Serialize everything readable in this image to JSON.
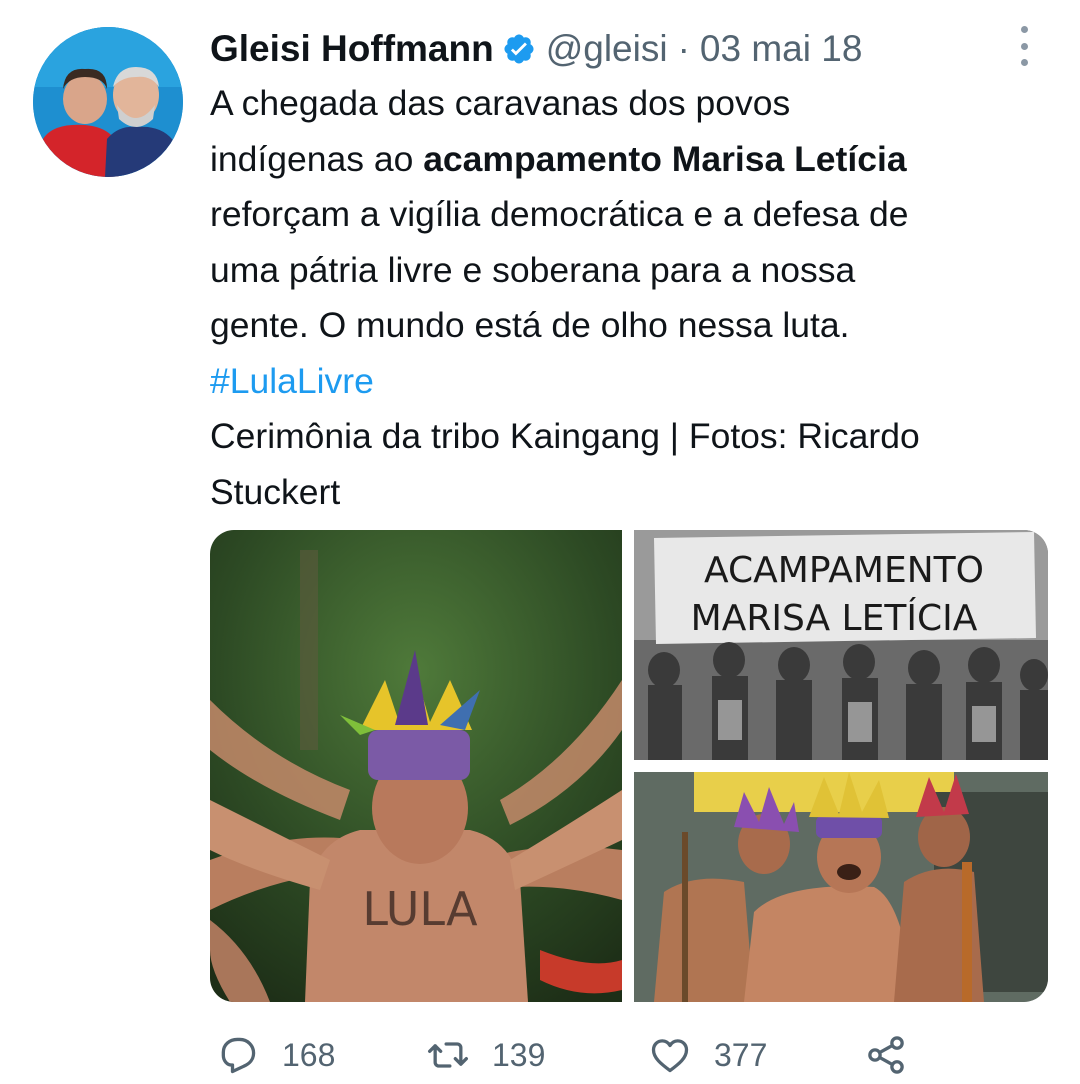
{
  "tweet": {
    "author_name": "Gleisi Hoffmann",
    "handle": "@gleisi",
    "separator": "·",
    "date": "03 mai 18",
    "text_lines": [
      "A chegada das caravanas dos povos",
      "indígenas ao ",
      "acampamento Marisa Letícia",
      "reforçam a vigília democrática e a defesa de",
      "uma pátria livre e soberana para a nossa",
      "gente.  O mundo está de olho nessa luta.",
      "#LulaLivre",
      "Cerimônia da tribo Kaingang  |  Fotos: Ricardo",
      "Stuckert"
    ],
    "media": {
      "banner_line1": "ACAMPAMENTO",
      "banner_line2": "MARISA LETÍCIA",
      "chest_text": "LULA"
    },
    "counts": {
      "replies": "168",
      "retweets": "139",
      "likes": "377"
    }
  },
  "colors": {
    "text": "#0f1419",
    "secondary": "#536471",
    "link": "#1d9bf0",
    "verified": "#1d9bf0"
  },
  "icons": {
    "verified": "verified-badge-icon",
    "more": "more-options-icon",
    "reply": "reply-icon",
    "retweet": "retweet-icon",
    "like": "heart-icon",
    "share": "share-icon"
  }
}
